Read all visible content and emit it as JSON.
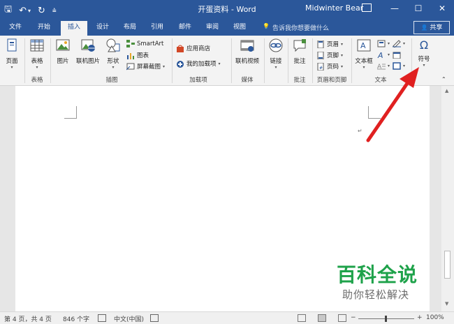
{
  "title_bar": {
    "doc_title": "开蛋资料 - Word",
    "user_name": "Midwinter Bear",
    "qat": {
      "save": "🖫",
      "undo": "↶",
      "undo_caret": "▾",
      "redo": "↻",
      "customize": "⩮"
    },
    "window": {
      "restore_ribbon": "",
      "minimize": "—",
      "maximize": "☐",
      "close": "✕"
    }
  },
  "tabs": {
    "file": "文件",
    "home": "开始",
    "insert": "插入",
    "design": "设计",
    "layout": "布局",
    "references": "引用",
    "mailings": "邮件",
    "review": "审阅",
    "view": "视图",
    "tell_me_icon": "💡",
    "tell_me": "告诉我你想要做什么",
    "share": "共享",
    "share_icon": "👤"
  },
  "ribbon": {
    "pages": {
      "page": "页面",
      "group": ""
    },
    "tables": {
      "table": "表格",
      "group": "表格"
    },
    "illustrations": {
      "picture": "图片",
      "online_picture": "联机图片",
      "shapes": "形状",
      "smartart": "SmartArt",
      "chart": "图表",
      "screenshot": "屏幕截图",
      "group": "插图"
    },
    "addins": {
      "store": "应用商店",
      "my_addins": "我的加载项",
      "group": "加载项"
    },
    "media": {
      "online_video": "联机视频",
      "group": "媒体"
    },
    "links": {
      "link": "链接"
    },
    "comments": {
      "comment": "批注",
      "group": "批注"
    },
    "header_footer": {
      "header": "页眉",
      "footer": "页脚",
      "page_number": "页码",
      "group": "页眉和页脚"
    },
    "text": {
      "textbox": "文本框",
      "group": "文本"
    },
    "symbols": {
      "symbol": "符号",
      "omega": "Ω"
    }
  },
  "document": {
    "para_mark": "↵"
  },
  "watermark": {
    "title": "百科全说",
    "subtitle": "助你轻松解决"
  },
  "status": {
    "page": "第 4 页，共 4 页",
    "words": "846 个字",
    "language": "中文(中国)",
    "zoom": "100%",
    "zoom_minus": "−",
    "zoom_plus": "+"
  },
  "colors": {
    "accent": "#2b579a",
    "arrow": "#e02020",
    "watermark_green": "#1ea24a"
  }
}
